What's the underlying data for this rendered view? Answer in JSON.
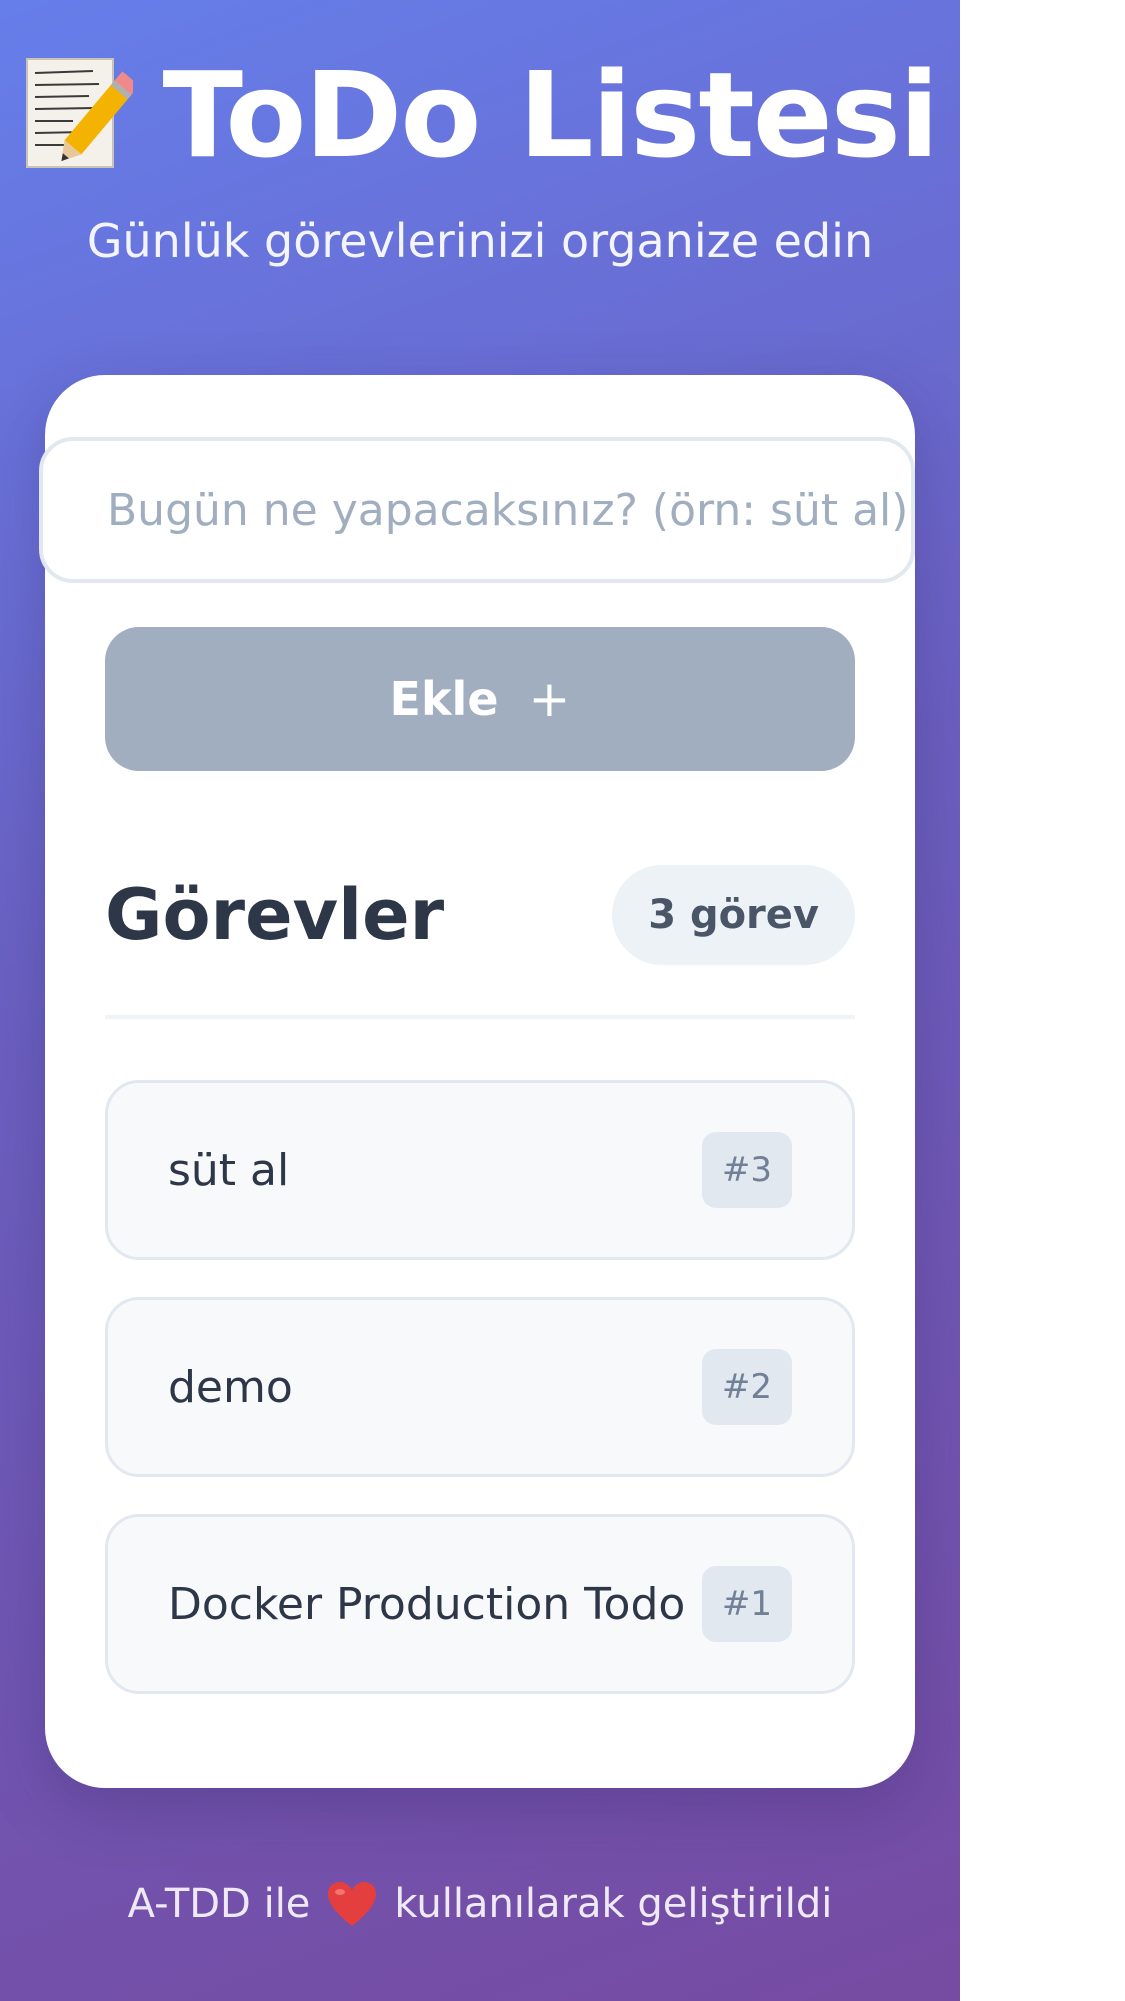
{
  "header": {
    "title": "ToDo Listesi",
    "subtitle": "Günlük görevlerinizi organize edin",
    "icon": "memo-icon"
  },
  "form": {
    "placeholder": "Bugün ne yapacaksınız? (örn: süt al)",
    "value": "",
    "add_label": "Ekle",
    "add_icon": "plus-icon",
    "add_disabled": true
  },
  "tasks": {
    "title": "Görevler",
    "count_label": "3 görev",
    "items": [
      {
        "text": "süt al",
        "id": "#3"
      },
      {
        "text": "demo",
        "id": "#2"
      },
      {
        "text": "Docker Production Todo",
        "id": "#1"
      }
    ]
  },
  "footer": {
    "before": "A-TDD ile",
    "icon": "heart-icon",
    "after": "kullanılarak geliştirildi"
  },
  "colors": {
    "gradient_start": "#667eea",
    "gradient_end": "#764ba2",
    "button_disabled": "#a0aec0",
    "text_dark": "#2d3748",
    "heart": "#e53e3e"
  }
}
